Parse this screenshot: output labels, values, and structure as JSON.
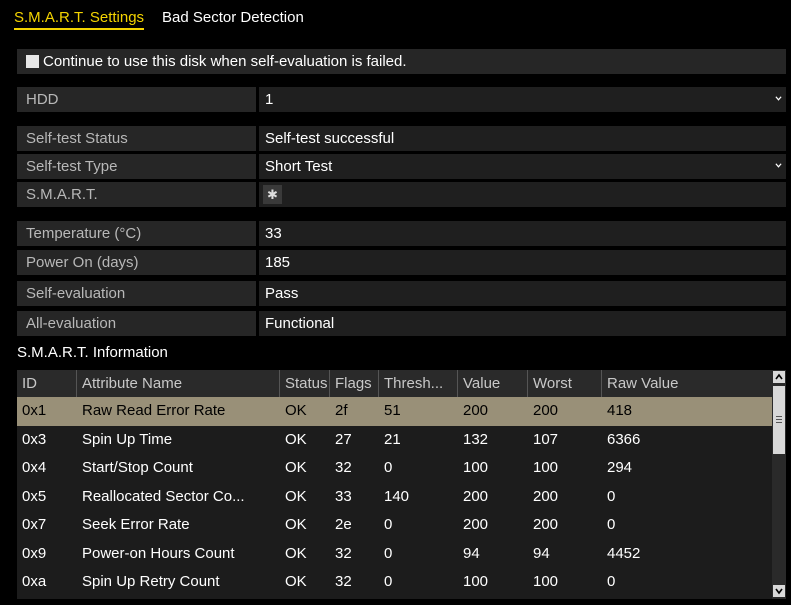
{
  "tabs": [
    {
      "label": "S.M.A.R.T. Settings",
      "active": true
    },
    {
      "label": "Bad Sector Detection",
      "active": false
    }
  ],
  "continue_checkbox": {
    "label": "Continue to use this disk when self-evaluation is failed.",
    "checked": false
  },
  "fields": {
    "hdd": {
      "label": "HDD",
      "value": "1"
    },
    "self_test_status": {
      "label": "Self-test Status",
      "value": "Self-test successful"
    },
    "self_test_type": {
      "label": "Self-test Type",
      "value": "Short Test"
    },
    "smart": {
      "label": "S.M.A.R.T.",
      "icon": "gear-icon"
    },
    "temperature": {
      "label": "Temperature (°C)",
      "value": "33"
    },
    "power_on": {
      "label": "Power On (days)",
      "value": "185"
    },
    "self_evaluation": {
      "label": "Self-evaluation",
      "value": "Pass"
    },
    "all_evaluation": {
      "label": "All-evaluation",
      "value": "Functional"
    }
  },
  "smart_info": {
    "title": "S.M.A.R.T. Information",
    "columns": [
      "ID",
      "Attribute Name",
      "Status",
      "Flags",
      "Thresh...",
      "Value",
      "Worst",
      "Raw Value"
    ],
    "rows": [
      [
        "0x1",
        "Raw Read Error Rate",
        "OK",
        "2f",
        "51",
        "200",
        "200",
        "418"
      ],
      [
        "0x3",
        "Spin Up Time",
        "OK",
        "27",
        "21",
        "132",
        "107",
        "6366"
      ],
      [
        "0x4",
        "Start/Stop Count",
        "OK",
        "32",
        "0",
        "100",
        "100",
        "294"
      ],
      [
        "0x5",
        "Reallocated Sector Co...",
        "OK",
        "33",
        "140",
        "200",
        "200",
        "0"
      ],
      [
        "0x7",
        "Seek Error Rate",
        "OK",
        "2e",
        "0",
        "200",
        "200",
        "0"
      ],
      [
        "0x9",
        "Power-on Hours Count",
        "OK",
        "32",
        "0",
        "94",
        "94",
        "4452"
      ],
      [
        "0xa",
        "Spin Up Retry Count",
        "OK",
        "32",
        "0",
        "100",
        "100",
        "0"
      ]
    ],
    "selected_row": 0
  },
  "colors": {
    "accent": "#f4d400",
    "selected_row": "#999078"
  }
}
